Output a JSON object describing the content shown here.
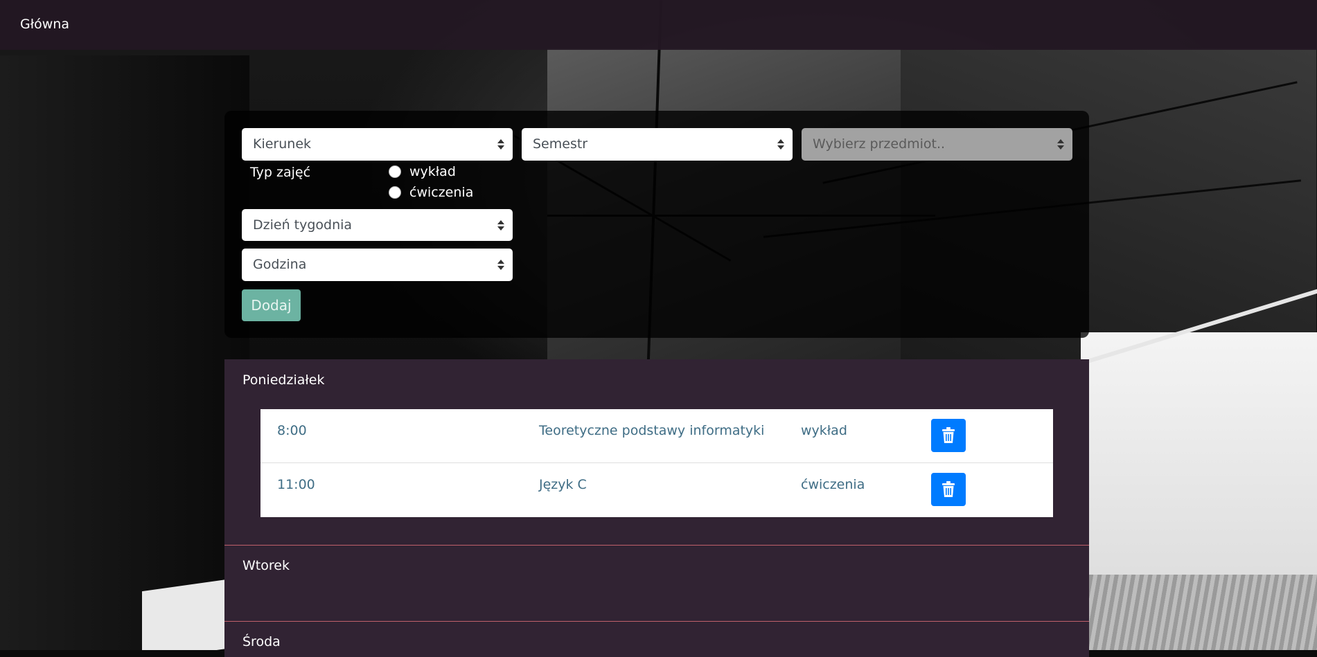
{
  "nav": {
    "home_label": "Główna"
  },
  "form": {
    "kierunek": "Kierunek",
    "semestr": "Semestr",
    "przedmiot": "Wybierz przedmiot..",
    "typ_label": "Typ zajęć",
    "typ_options": [
      "wykład",
      "ćwiczenia"
    ],
    "dzien": "Dzień tygodnia",
    "godzina": "Godzina",
    "add_button": "Dodaj"
  },
  "schedule": {
    "days": [
      {
        "name": "Poniedziałek",
        "lessons": [
          {
            "time": "8:00",
            "subject": "Teoretyczne podstawy informatyki",
            "type": "wykład",
            "delete_icon": "trash-icon"
          },
          {
            "time": "11:00",
            "subject": "Język C",
            "type": "ćwiczenia",
            "delete_icon": "trash-icon"
          }
        ]
      },
      {
        "name": "Wtorek",
        "lessons": []
      },
      {
        "name": "Środa",
        "lessons": []
      }
    ]
  },
  "colors": {
    "navbar": "#241824",
    "schedule_panel": "#312333",
    "add_button": "#6cb3a2",
    "delete_button": "#007bff",
    "lesson_text": "#3f6d85",
    "divider": "#c0606a"
  }
}
